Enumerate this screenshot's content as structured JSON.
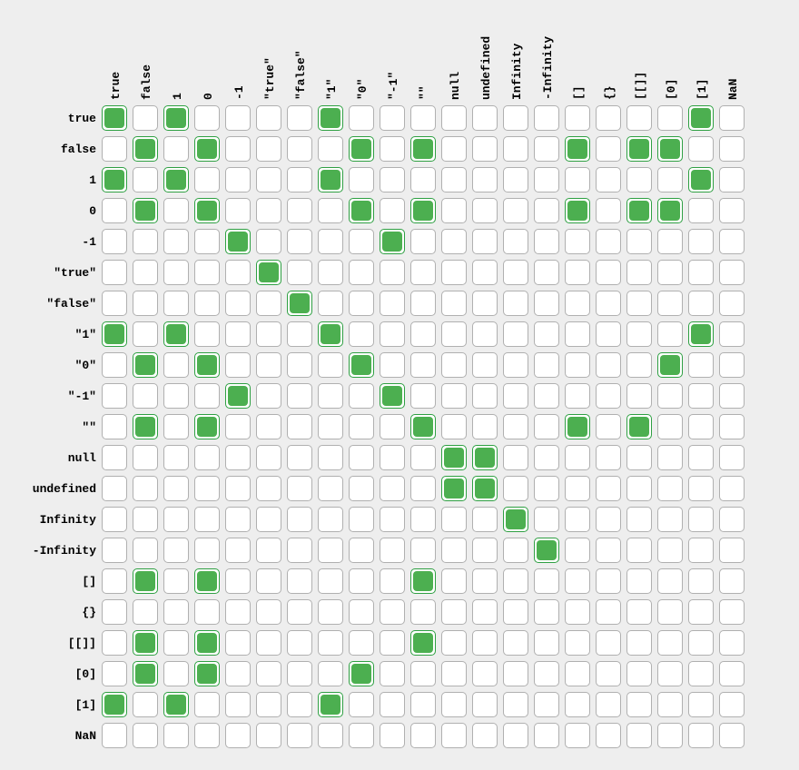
{
  "chart_data": {
    "type": "heatmap",
    "title": "",
    "labels": [
      "true",
      "false",
      "1",
      "0",
      "-1",
      "\"true\"",
      "\"false\"",
      "\"1\"",
      "\"0\"",
      "\"-1\"",
      "\"\"",
      "null",
      "undefined",
      "Infinity",
      "-Infinity",
      "[]",
      "{}",
      "[[]]",
      "[0]",
      "[1]",
      "NaN"
    ],
    "true_color": "#4CAF50",
    "false_color": "#ffffff",
    "matrix": [
      [
        1,
        0,
        1,
        0,
        0,
        0,
        0,
        1,
        0,
        0,
        0,
        0,
        0,
        0,
        0,
        0,
        0,
        0,
        0,
        1,
        0
      ],
      [
        0,
        1,
        0,
        1,
        0,
        0,
        0,
        0,
        1,
        0,
        1,
        0,
        0,
        0,
        0,
        1,
        0,
        1,
        1,
        0,
        0
      ],
      [
        1,
        0,
        1,
        0,
        0,
        0,
        0,
        1,
        0,
        0,
        0,
        0,
        0,
        0,
        0,
        0,
        0,
        0,
        0,
        1,
        0
      ],
      [
        0,
        1,
        0,
        1,
        0,
        0,
        0,
        0,
        1,
        0,
        1,
        0,
        0,
        0,
        0,
        1,
        0,
        1,
        1,
        0,
        0
      ],
      [
        0,
        0,
        0,
        0,
        1,
        0,
        0,
        0,
        0,
        1,
        0,
        0,
        0,
        0,
        0,
        0,
        0,
        0,
        0,
        0,
        0
      ],
      [
        0,
        0,
        0,
        0,
        0,
        1,
        0,
        0,
        0,
        0,
        0,
        0,
        0,
        0,
        0,
        0,
        0,
        0,
        0,
        0,
        0
      ],
      [
        0,
        0,
        0,
        0,
        0,
        0,
        1,
        0,
        0,
        0,
        0,
        0,
        0,
        0,
        0,
        0,
        0,
        0,
        0,
        0,
        0
      ],
      [
        1,
        0,
        1,
        0,
        0,
        0,
        0,
        1,
        0,
        0,
        0,
        0,
        0,
        0,
        0,
        0,
        0,
        0,
        0,
        1,
        0
      ],
      [
        0,
        1,
        0,
        1,
        0,
        0,
        0,
        0,
        1,
        0,
        0,
        0,
        0,
        0,
        0,
        0,
        0,
        0,
        1,
        0,
        0
      ],
      [
        0,
        0,
        0,
        0,
        1,
        0,
        0,
        0,
        0,
        1,
        0,
        0,
        0,
        0,
        0,
        0,
        0,
        0,
        0,
        0,
        0
      ],
      [
        0,
        1,
        0,
        1,
        0,
        0,
        0,
        0,
        0,
        0,
        1,
        0,
        0,
        0,
        0,
        1,
        0,
        1,
        0,
        0,
        0
      ],
      [
        0,
        0,
        0,
        0,
        0,
        0,
        0,
        0,
        0,
        0,
        0,
        1,
        1,
        0,
        0,
        0,
        0,
        0,
        0,
        0,
        0
      ],
      [
        0,
        0,
        0,
        0,
        0,
        0,
        0,
        0,
        0,
        0,
        0,
        1,
        1,
        0,
        0,
        0,
        0,
        0,
        0,
        0,
        0
      ],
      [
        0,
        0,
        0,
        0,
        0,
        0,
        0,
        0,
        0,
        0,
        0,
        0,
        0,
        1,
        0,
        0,
        0,
        0,
        0,
        0,
        0
      ],
      [
        0,
        0,
        0,
        0,
        0,
        0,
        0,
        0,
        0,
        0,
        0,
        0,
        0,
        0,
        1,
        0,
        0,
        0,
        0,
        0,
        0
      ],
      [
        0,
        1,
        0,
        1,
        0,
        0,
        0,
        0,
        0,
        0,
        1,
        0,
        0,
        0,
        0,
        0,
        0,
        0,
        0,
        0,
        0
      ],
      [
        0,
        0,
        0,
        0,
        0,
        0,
        0,
        0,
        0,
        0,
        0,
        0,
        0,
        0,
        0,
        0,
        0,
        0,
        0,
        0,
        0
      ],
      [
        0,
        1,
        0,
        1,
        0,
        0,
        0,
        0,
        0,
        0,
        1,
        0,
        0,
        0,
        0,
        0,
        0,
        0,
        0,
        0,
        0
      ],
      [
        0,
        1,
        0,
        1,
        0,
        0,
        0,
        0,
        1,
        0,
        0,
        0,
        0,
        0,
        0,
        0,
        0,
        0,
        0,
        0,
        0
      ],
      [
        1,
        0,
        1,
        0,
        0,
        0,
        0,
        1,
        0,
        0,
        0,
        0,
        0,
        0,
        0,
        0,
        0,
        0,
        0,
        0,
        0
      ],
      [
        0,
        0,
        0,
        0,
        0,
        0,
        0,
        0,
        0,
        0,
        0,
        0,
        0,
        0,
        0,
        0,
        0,
        0,
        0,
        0,
        0
      ]
    ]
  }
}
